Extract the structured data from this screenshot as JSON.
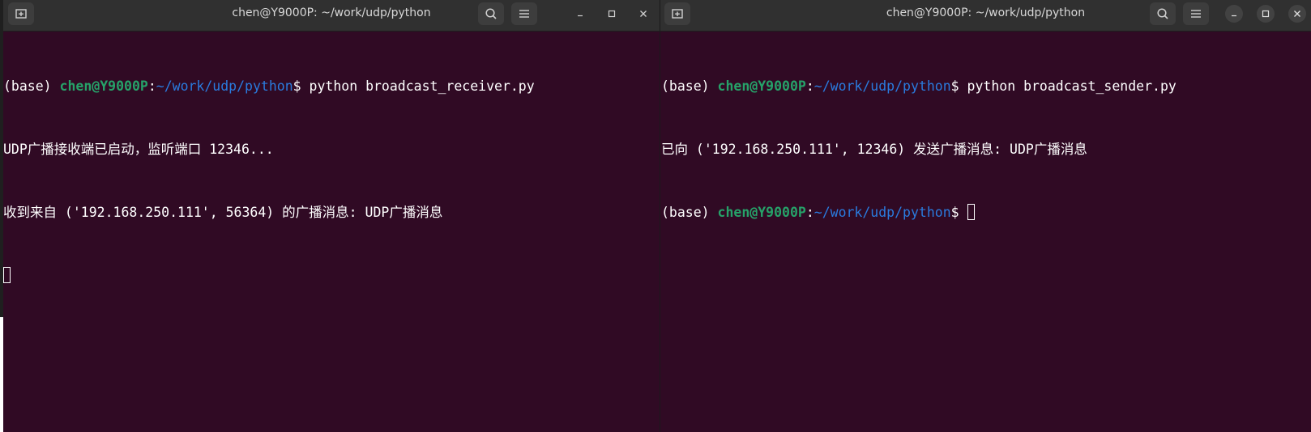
{
  "left_window": {
    "title": "chen@Y9000P: ~/work/udp/python",
    "lines": [
      {
        "env": "(base) ",
        "user": "chen@Y9000P",
        "colon": ":",
        "path": "~/work/udp/python",
        "prompt": "$ ",
        "command": "python broadcast_receiver.py"
      },
      {
        "text": "UDP广播接收端已启动，监听端口 12346..."
      },
      {
        "text": "收到来自 ('192.168.250.111', 56364) 的广播消息: UDP广播消息"
      }
    ]
  },
  "right_window": {
    "title": "chen@Y9000P: ~/work/udp/python",
    "lines": [
      {
        "env": "(base) ",
        "user": "chen@Y9000P",
        "colon": ":",
        "path": "~/work/udp/python",
        "prompt": "$ ",
        "command": "python broadcast_sender.py"
      },
      {
        "text": "已向 ('192.168.250.111', 12346) 发送广播消息: UDP广播消息"
      },
      {
        "env": "(base) ",
        "user": "chen@Y9000P",
        "colon": ":",
        "path": "~/work/udp/python",
        "prompt": "$ ",
        "command": ""
      }
    ]
  },
  "colors": {
    "terminal_bg": "#300a24",
    "titlebar_bg": "#303030",
    "user_green": "#26a269",
    "path_blue": "#2a7bde"
  },
  "icons": {
    "new_tab": "new-tab-icon",
    "search": "search-icon",
    "menu": "hamburger-menu-icon",
    "minimize": "minimize-icon",
    "maximize": "maximize-icon",
    "close": "close-icon"
  }
}
